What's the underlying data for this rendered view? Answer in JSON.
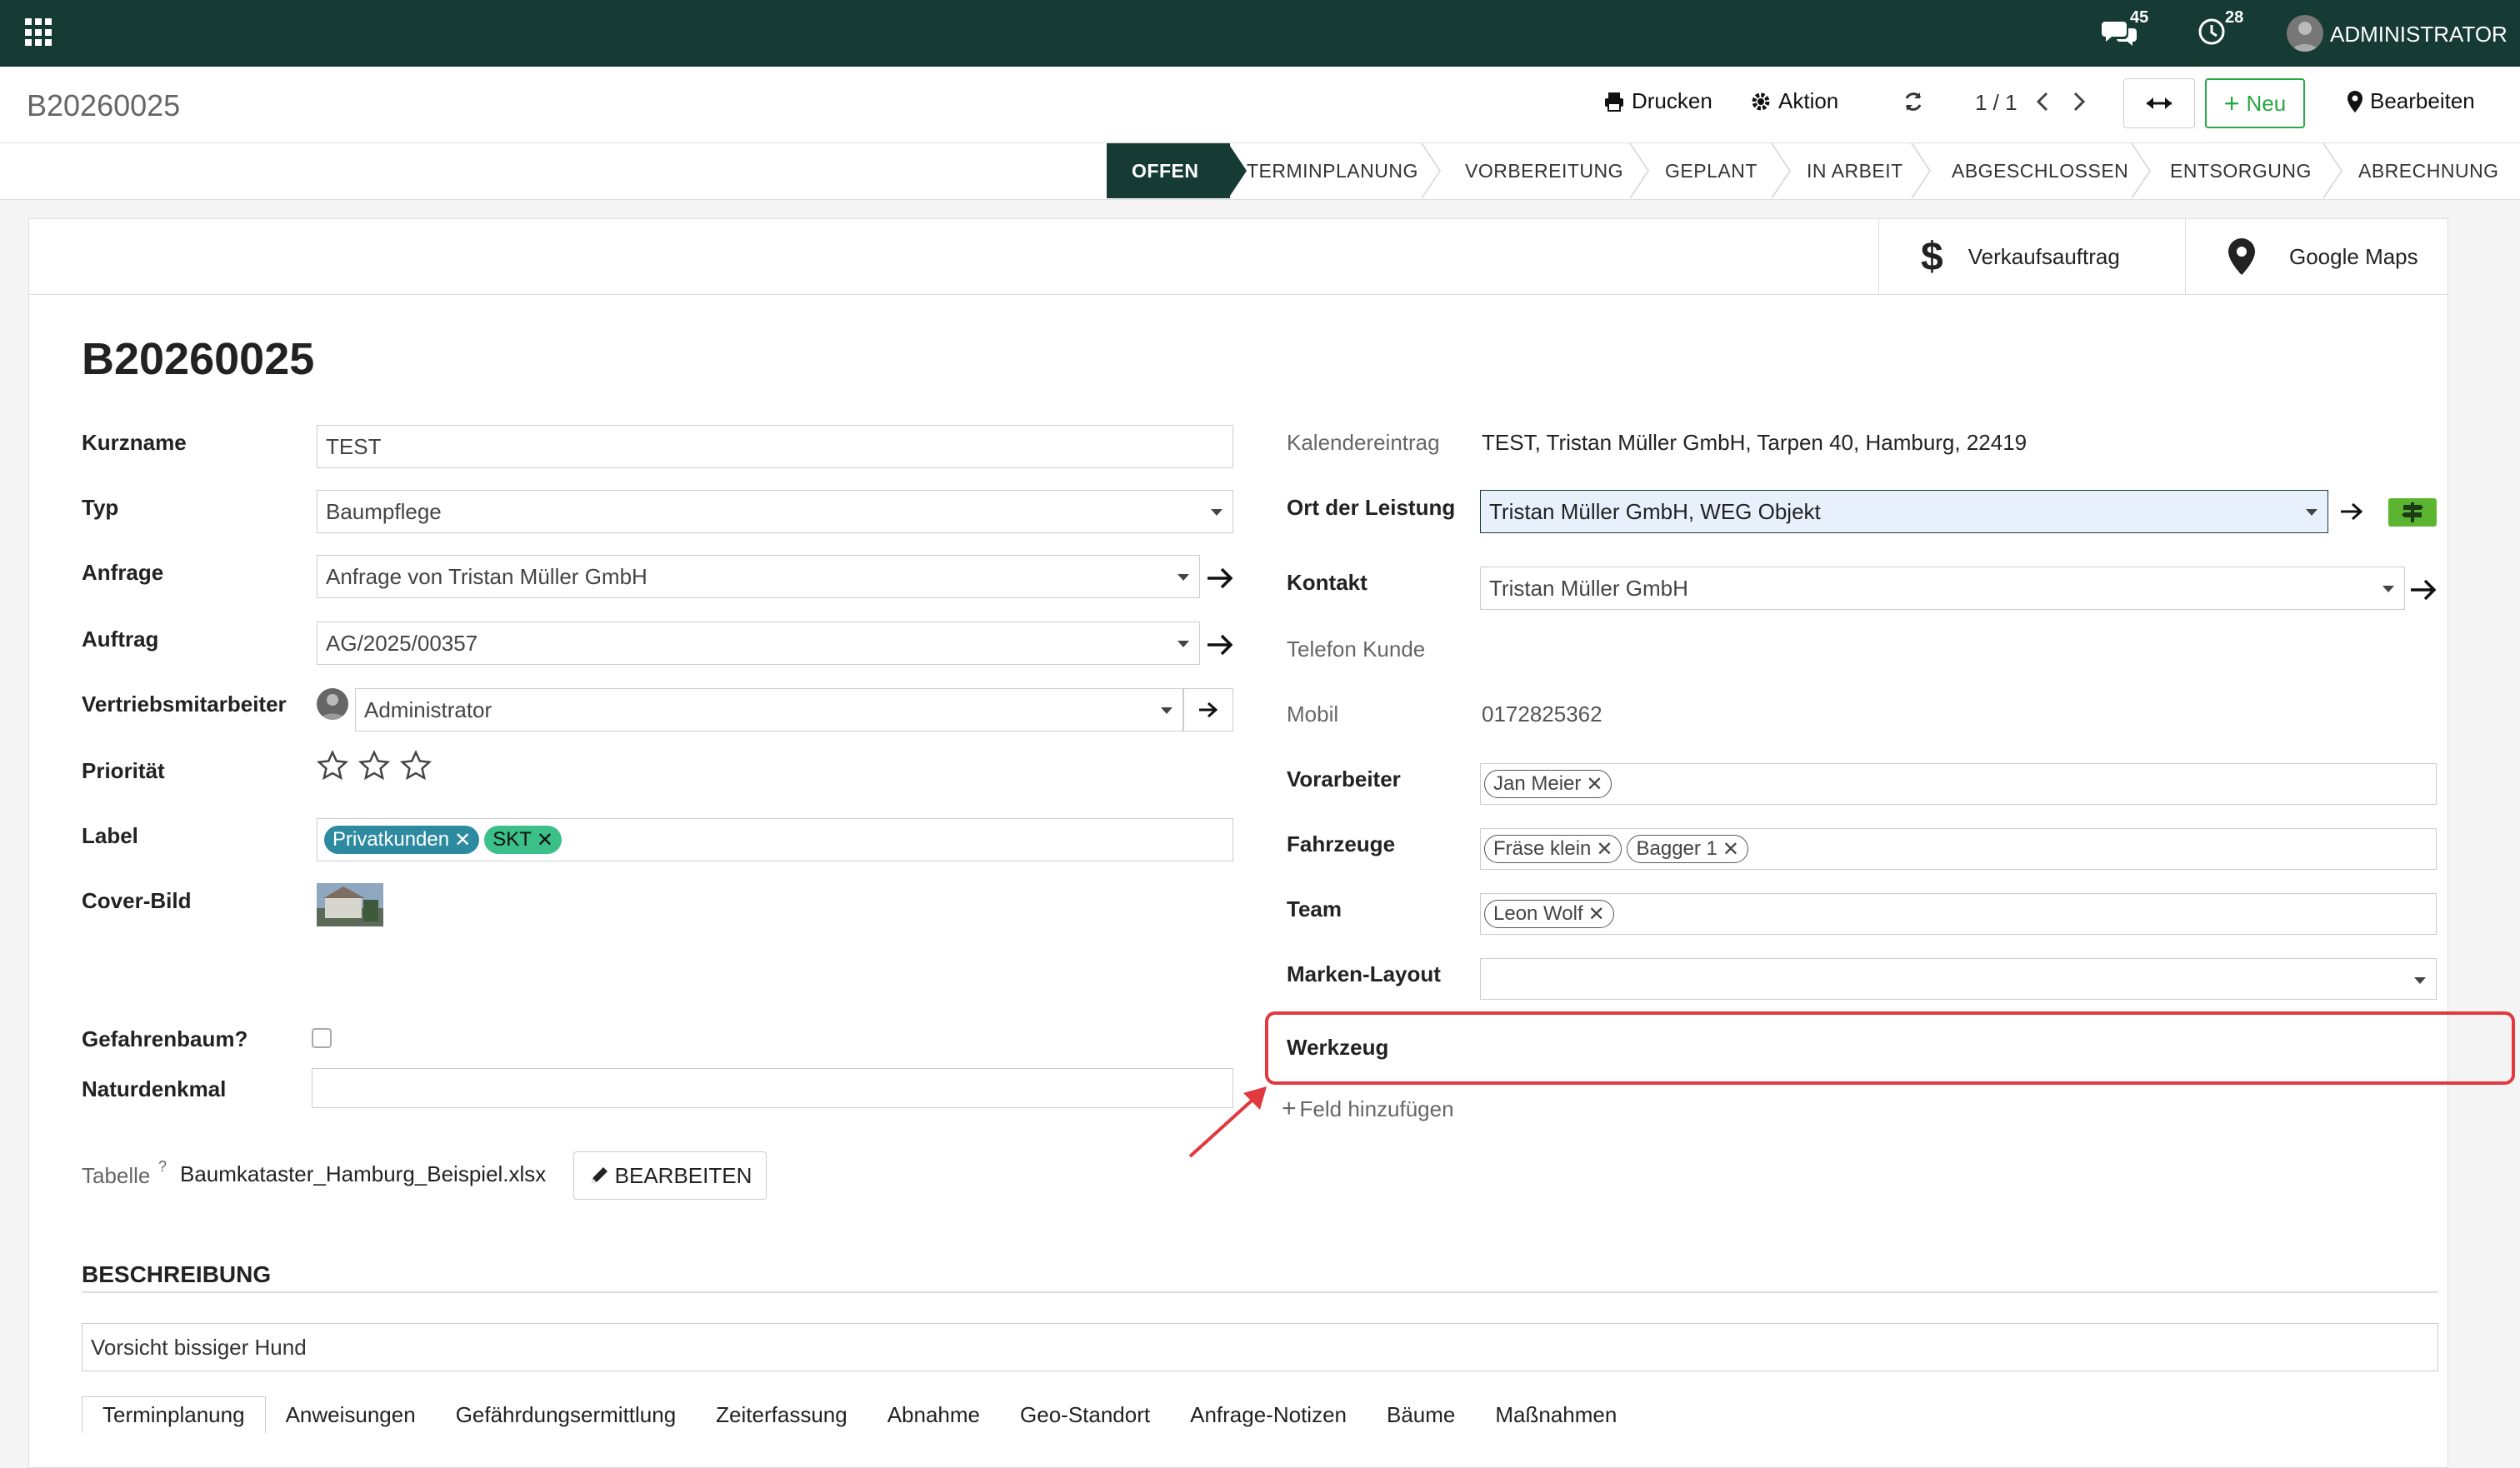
{
  "topbar": {
    "messages_count": "45",
    "activities_count": "28",
    "user_name": "ADMINISTRATOR"
  },
  "control": {
    "breadcrumb": "B20260025",
    "print": "Drucken",
    "action": "Aktion",
    "pager": "1 / 1",
    "new": "Neu",
    "edit": "Bearbeiten"
  },
  "stages": [
    "OFFEN",
    "TERMINPLANUNG",
    "VORBEREITUNG",
    "GEPLANT",
    "IN ARBEIT",
    "ABGESCHLOSSEN",
    "ENTSORGUNG",
    "ABRECHNUNG"
  ],
  "smart_buttons": {
    "sales_order": "Verkaufsauftrag",
    "maps": "Google Maps"
  },
  "record": {
    "title": "B20260025",
    "left": {
      "kurzname_label": "Kurzname",
      "kurzname": "TEST",
      "typ_label": "Typ",
      "typ": "Baumpflege",
      "anfrage_label": "Anfrage",
      "anfrage": "Anfrage von Tristan Müller GmbH",
      "auftrag_label": "Auftrag",
      "auftrag": "AG/2025/00357",
      "vertrieb_label": "Vertriebsmitarbeiter",
      "vertrieb": "Administrator",
      "prio_label": "Priorität",
      "label_label": "Label",
      "tags": [
        "Privatkunden",
        "SKT"
      ],
      "cover_label": "Cover-Bild",
      "gefahr_label": "Gefahrenbaum?",
      "natur_label": "Naturdenkmal",
      "tabelle_label": "Tabelle",
      "tabelle_help": "?",
      "tabelle_file": "Baumkataster_Hamburg_Beispiel.xlsx",
      "tabelle_btn": "BEARBEITEN"
    },
    "right": {
      "kalender_label": "Kalendereintrag",
      "kalender": "TEST, Tristan Müller GmbH, Tarpen 40, Hamburg, 22419",
      "ort_label": "Ort der Leistung",
      "ort": "Tristan Müller GmbH, WEG Objekt",
      "kontakt_label": "Kontakt",
      "kontakt": "Tristan Müller GmbH",
      "telefon_label": "Telefon Kunde",
      "mobil_label": "Mobil",
      "mobil": "0172825362",
      "vorarbeiter_label": "Vorarbeiter",
      "vorarbeiter": [
        "Jan Meier"
      ],
      "fahrzeuge_label": "Fahrzeuge",
      "fahrzeuge": [
        "Fräse klein",
        "Bagger 1"
      ],
      "team_label": "Team",
      "team": [
        "Leon Wolf"
      ],
      "marken_label": "Marken-Layout",
      "werkzeug_label": "Werkzeug",
      "add_field": "Feld hinzufügen"
    },
    "beschreibung_title": "BESCHREIBUNG",
    "beschreibung": "Vorsicht bissiger Hund"
  },
  "tabs": [
    "Terminplanung",
    "Anweisungen",
    "Gefährdungsermittlung",
    "Zeiterfassung",
    "Abnahme",
    "Geo-Standort",
    "Anfrage-Notizen",
    "Bäume",
    "Maßnahmen"
  ],
  "colors": {
    "navbar": "#163b35",
    "tag_blue": "#2e8aa0",
    "tag_green": "#3bc08a",
    "highlight_red": "#e0393e",
    "new_green": "#28a745"
  }
}
